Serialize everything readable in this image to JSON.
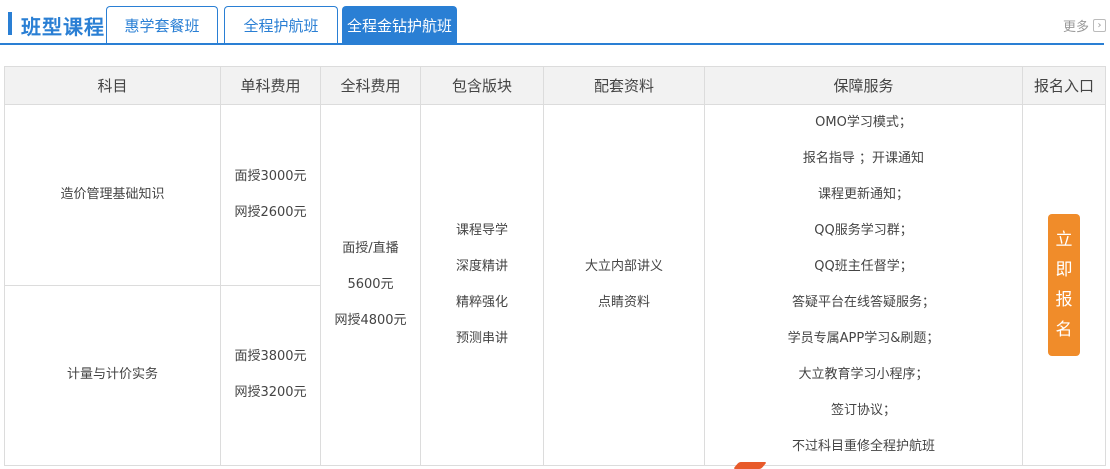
{
  "header": {
    "title": "班型课程",
    "tabs": [
      {
        "label": "惠学套餐班"
      },
      {
        "label": "全程护航班"
      },
      {
        "label": "全程金钻护航班"
      }
    ],
    "more_label": "更多",
    "more_icon": "chevron-right-icon",
    "accent_color": "#2a7fd4"
  },
  "table": {
    "columns": [
      "科目",
      "单科费用",
      "全科费用",
      "包含版块",
      "配套资料",
      "保障服务",
      "报名入口"
    ],
    "subjects": [
      {
        "name": "造价管理基础知识",
        "fees": [
          "面授3000元",
          "网授2600元"
        ]
      },
      {
        "name": "计量与计价实务",
        "fees": [
          "面授3800元",
          "网授3200元"
        ]
      }
    ],
    "full_fee": [
      "面授/直播",
      "5600元",
      "网授4800元"
    ],
    "modules": [
      "课程导学",
      "深度精讲",
      "精粹强化",
      "预测串讲"
    ],
    "materials": [
      "大立内部讲义",
      "点睛资料"
    ],
    "services": [
      "OMO学习模式；",
      "报名指导 ；开课通知",
      "课程更新通知；",
      "QQ服务学习群；",
      "QQ班主任督学；",
      "答疑平台在线答疑服务；",
      "学员专属APP学习&刷题；",
      "大立教育学习小程序；",
      "签订协议；",
      "不过科目重修全程护航班"
    ],
    "signup_chars": [
      "立",
      "即",
      "报",
      "名"
    ],
    "signup_color": "#f08c2a"
  }
}
